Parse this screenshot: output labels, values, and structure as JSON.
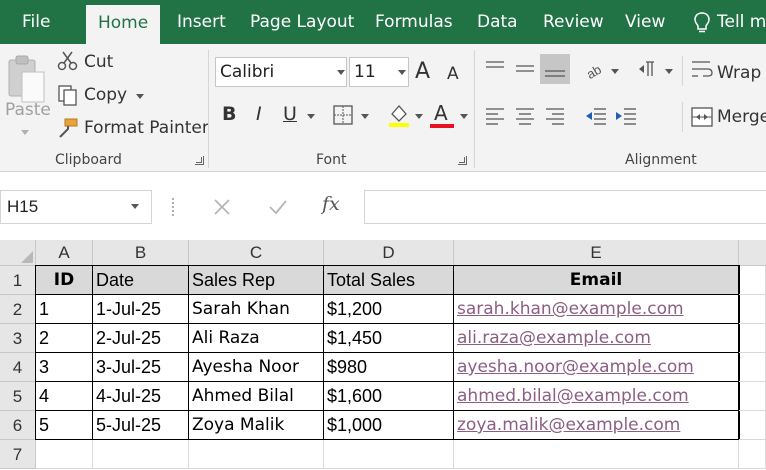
{
  "menu": {
    "file": "File",
    "home": "Home",
    "insert": "Insert",
    "page_layout": "Page Layout",
    "formulas": "Formulas",
    "data": "Data",
    "review": "Review",
    "view": "View",
    "tell_me": "Tell me"
  },
  "ribbon": {
    "clipboard": {
      "paste": "Paste",
      "cut": "Cut",
      "copy": "Copy",
      "format_painter": "Format Painter",
      "label": "Clipboard"
    },
    "font": {
      "font_name": "Calibri",
      "font_size": "11",
      "label": "Font",
      "bold": "B",
      "italic": "I",
      "underline": "U",
      "font_color": "A",
      "grow": "A",
      "shrink": "A",
      "font_color_hex": "#e81123"
    },
    "alignment": {
      "wrap": "Wrap",
      "merge": "Merge",
      "label": "Alignment"
    }
  },
  "formula_bar": {
    "name_box": "H15",
    "fx": "fx",
    "value": ""
  },
  "sheet": {
    "columns": [
      "A",
      "B",
      "C",
      "D",
      "E"
    ],
    "rows": [
      "1",
      "2",
      "3",
      "4",
      "5",
      "6",
      "7"
    ],
    "header": {
      "id": "ID",
      "date": "Date",
      "sales_rep": "Sales Rep",
      "total_sales": "Total Sales",
      "email": "Email"
    },
    "data": [
      {
        "id": "1",
        "date": "1-Jul-25",
        "rep": "Sarah Khan",
        "sales": "$1,200",
        "email": "sarah.khan@example.com"
      },
      {
        "id": "2",
        "date": "2-Jul-25",
        "rep": "Ali Raza",
        "sales": "$1,450",
        "email": "ali.raza@example.com"
      },
      {
        "id": "3",
        "date": "3-Jul-25",
        "rep": "Ayesha Noor",
        "sales": "$980",
        "email": "ayesha.noor@example.com"
      },
      {
        "id": "4",
        "date": "4-Jul-25",
        "rep": "Ahmed Bilal",
        "sales": "$1,600",
        "email": "ahmed.bilal@example.com"
      },
      {
        "id": "5",
        "date": "5-Jul-25",
        "rep": "Zoya Malik",
        "sales": "$1,000",
        "email": "zoya.malik@example.com"
      }
    ]
  },
  "colors": {
    "brand": "#217346",
    "link": "#8b5e83",
    "header_fill": "#d9d9d9"
  }
}
